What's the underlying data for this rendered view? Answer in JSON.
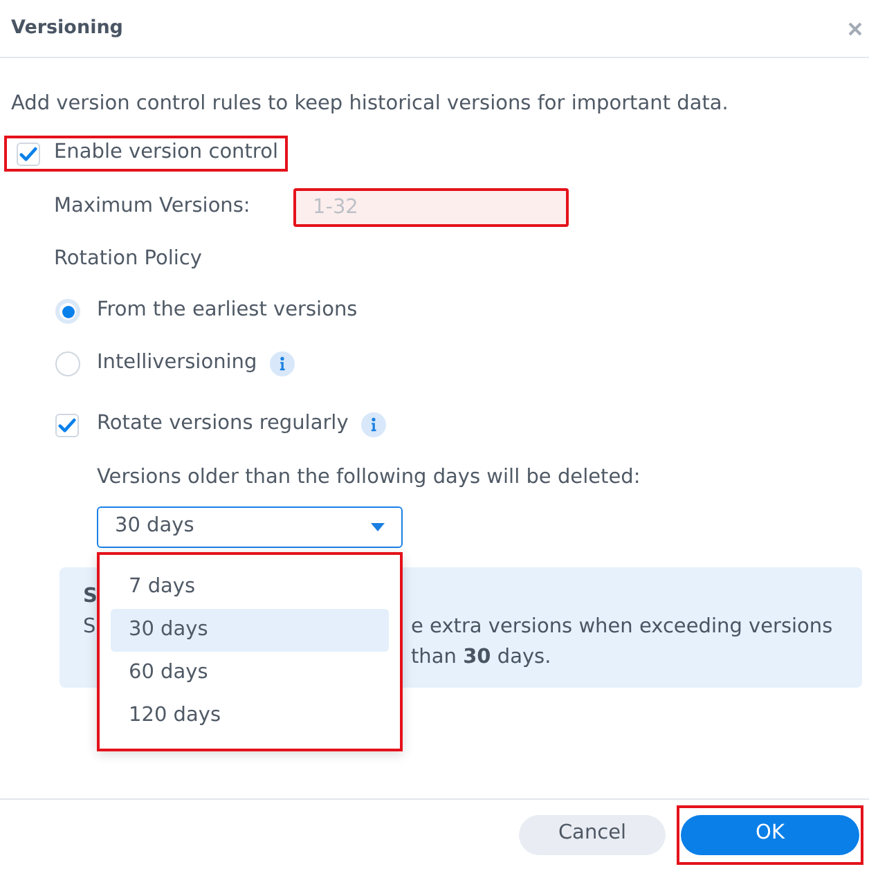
{
  "dialog": {
    "title": "Versioning"
  },
  "description": "Add version control rules to keep historical versions for important data.",
  "enable_version_control": {
    "label": "Enable version control",
    "checked": true,
    "highlighted": true
  },
  "maximum_versions": {
    "label": "Maximum Versions:",
    "placeholder": "1-32",
    "invalid": true,
    "highlighted": true
  },
  "rotation_policy": {
    "label": "Rotation Policy",
    "options": [
      {
        "label": "From the earliest versions",
        "selected": true,
        "info": false
      },
      {
        "label": "Intelliversioning",
        "selected": false,
        "info": true
      }
    ]
  },
  "rotate_regularly": {
    "label": "Rotate versions regularly",
    "checked": true,
    "info": true
  },
  "retention": {
    "label": "Versions older than the following days will be deleted:",
    "value": "30 days",
    "expanded": true,
    "highlighted": true,
    "options": [
      {
        "label": "7 days",
        "selected": false
      },
      {
        "label": "30 days",
        "selected": true
      },
      {
        "label": "60 days",
        "selected": false
      },
      {
        "label": "120 days",
        "selected": false
      }
    ]
  },
  "note": {
    "title": "S",
    "lines": [
      {
        "left": "S",
        "right": "e extra versions when exceeding versions"
      },
      {
        "right": "than **30** days."
      }
    ]
  },
  "buttons": [
    {
      "label": "Cancel",
      "kind": "secondary",
      "highlighted": false
    },
    {
      "label": "OK",
      "kind": "primary",
      "highlighted": true
    }
  ]
}
